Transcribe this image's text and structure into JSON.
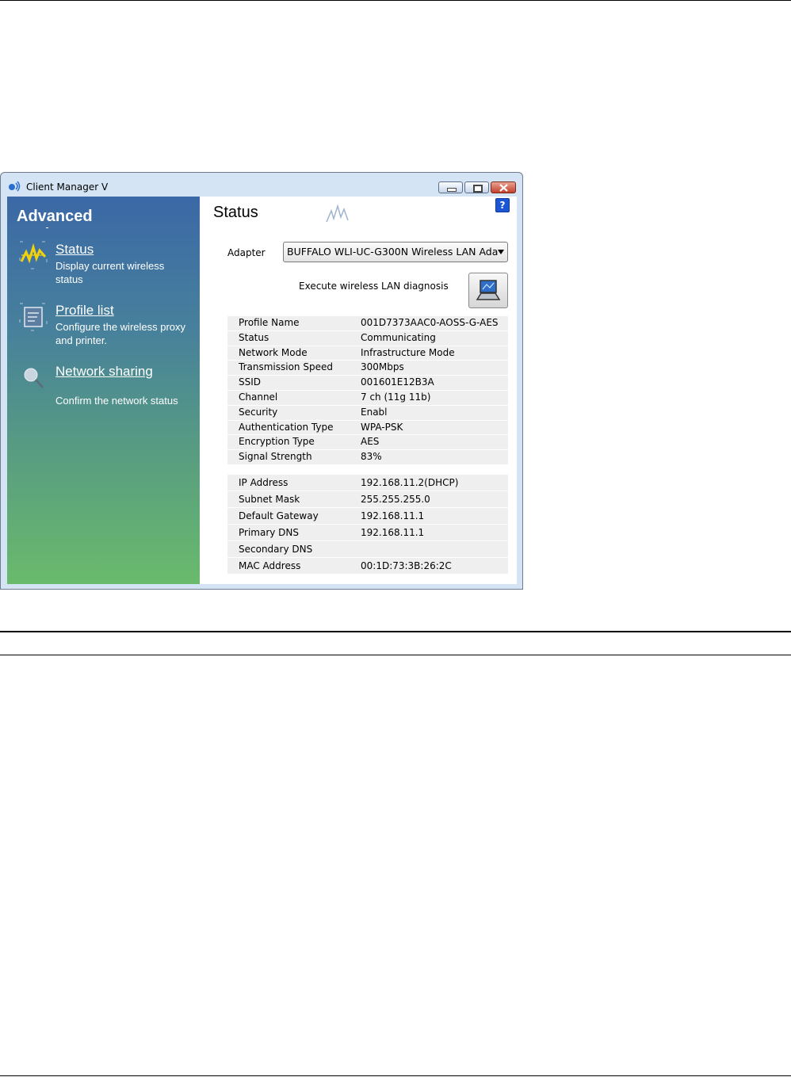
{
  "window": {
    "title": "Client Manager V",
    "buttons": {
      "minimize": "minimize-icon",
      "maximize": "maximize-icon",
      "close": "close-icon"
    }
  },
  "sidebar": {
    "title": "Advanced",
    "items": [
      {
        "label": "Status",
        "description": "Display current wireless status",
        "icon": "status-wave-icon"
      },
      {
        "label": "Profile list",
        "description": "Configure the wireless proxy and printer.",
        "icon": "profile-list-icon"
      },
      {
        "label": "Network sharing",
        "description": "Confirm the network status",
        "icon": "network-sharing-icon"
      }
    ]
  },
  "main": {
    "title": "Status",
    "help": "?",
    "adapter_label": "Adapter",
    "adapter_value": "BUFFALO WLI-UC-G300N  Wireless LAN Ada",
    "diagnosis_label": "Execute wireless LAN diagnosis",
    "wireless_info": [
      {
        "key": "Profile Name",
        "value": "001D7373AAC0-AOSS-G-AES"
      },
      {
        "key": "Status",
        "value": "Communicating"
      },
      {
        "key": "Network Mode",
        "value": "Infrastructure Mode"
      },
      {
        "key": "Transmission Speed",
        "value": "300Mbps"
      },
      {
        "key": "SSID",
        "value": "001601E12B3A"
      },
      {
        "key": "Channel",
        "value": "7 ch (11g 11b)"
      },
      {
        "key": "Security",
        "value": "Enabl"
      },
      {
        "key": "Authentication Type",
        "value": "WPA-PSK"
      },
      {
        "key": "Encryption Type",
        "value": "AES"
      },
      {
        "key": "Signal Strength",
        "value": "83%"
      }
    ],
    "network_info": [
      {
        "key": "IP Address",
        "value": "192.168.11.2(DHCP)"
      },
      {
        "key": "Subnet Mask",
        "value": "255.255.255.0"
      },
      {
        "key": "Default Gateway",
        "value": "192.168.11.1"
      },
      {
        "key": "Primary DNS",
        "value": "192.168.11.1"
      },
      {
        "key": "Secondary DNS",
        "value": ""
      },
      {
        "key": "MAC Address",
        "value": "00:1D:73:3B:26:2C"
      }
    ]
  },
  "colors": {
    "sidebar_top": "#3b68a6",
    "sidebar_bottom": "#6aba6c",
    "row_bg": "#efefef",
    "help_blue": "#1a56d6"
  }
}
